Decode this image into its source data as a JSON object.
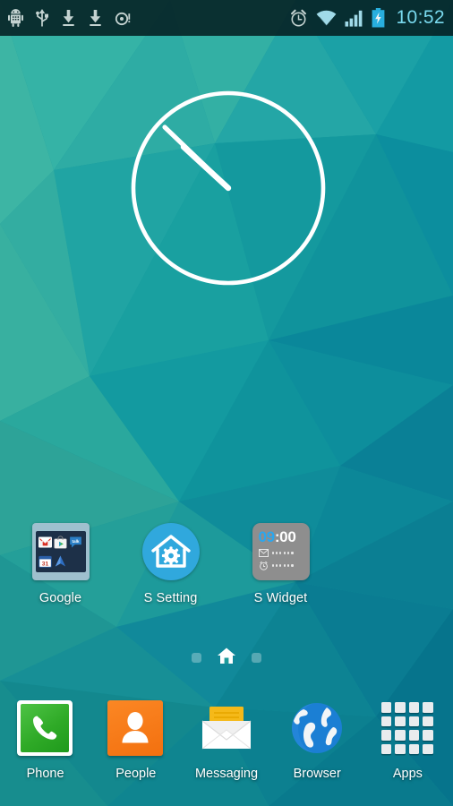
{
  "status_bar": {
    "time": "10:52",
    "time_color": "#79d9ee",
    "background": "rgba(4,30,33,0.88)",
    "left_icons": [
      {
        "name": "android-debug-icon",
        "title": "USB debugging"
      },
      {
        "name": "usb-icon",
        "title": "USB connected"
      },
      {
        "name": "download-icon",
        "title": "Download"
      },
      {
        "name": "download-icon-2",
        "title": "Download"
      },
      {
        "name": "storage-alert-icon",
        "title": "Storage"
      }
    ],
    "right_icons": [
      {
        "name": "alarm-clock-icon",
        "title": "Alarm set"
      },
      {
        "name": "wifi-icon",
        "title": "Wi-Fi full signal"
      },
      {
        "name": "cellular-signal-icon",
        "title": "Signal bars"
      },
      {
        "name": "battery-charging-icon",
        "title": "Battery charging",
        "color": "#2ab6e8"
      }
    ]
  },
  "wallpaper": {
    "name": "low-poly-teal-wallpaper",
    "colors": [
      "#2fa99e",
      "#16a3a6",
      "#0f9aa5",
      "#0d8fa0",
      "#1793a0",
      "#0e7f96",
      "#14868f",
      "#2c9f9b",
      "#0b6f88",
      "#127f93"
    ]
  },
  "clock_widget": {
    "name": "analog-clock-widget",
    "stroke_color": "#ffffff",
    "hour_hand_angle": -42,
    "minute_hand_angle": -58
  },
  "home_icons": [
    {
      "label": "Google",
      "type": "folder",
      "folder_background": "#9fc0ce",
      "folder_inner": "#1d3048",
      "contents": [
        "Gmail",
        "Play Store",
        "Talk",
        "Calendar",
        "Maps"
      ]
    },
    {
      "label": "S Setting",
      "type": "app",
      "icon": "house-gear-icon",
      "color": "#30a8dd"
    },
    {
      "label": "S Widget",
      "type": "widget",
      "time_hours": "09",
      "time_separator_minutes": ":00",
      "hours_color": "#2aa7ef",
      "minutes_color": "#ffffff",
      "background": "#8e8e8e",
      "rows": [
        {
          "icon": "mail-icon",
          "dots": 6
        },
        {
          "icon": "alarm-icon",
          "dots": 6
        }
      ]
    }
  ],
  "page_indicator": {
    "pages": 3,
    "current": 2,
    "current_icon": "home-icon"
  },
  "dock": [
    {
      "label": "Phone",
      "icon": "phone-handset-icon",
      "color": "#2faa27"
    },
    {
      "label": "People",
      "icon": "person-icon",
      "color": "#f3700f"
    },
    {
      "label": "Messaging",
      "icon": "envelope-icon",
      "color": "#f2b705"
    },
    {
      "label": "Browser",
      "icon": "globe-icon",
      "color": "#1b7fd4"
    },
    {
      "label": "Apps",
      "icon": "apps-grid-icon",
      "color": "#e9ecee"
    }
  ]
}
